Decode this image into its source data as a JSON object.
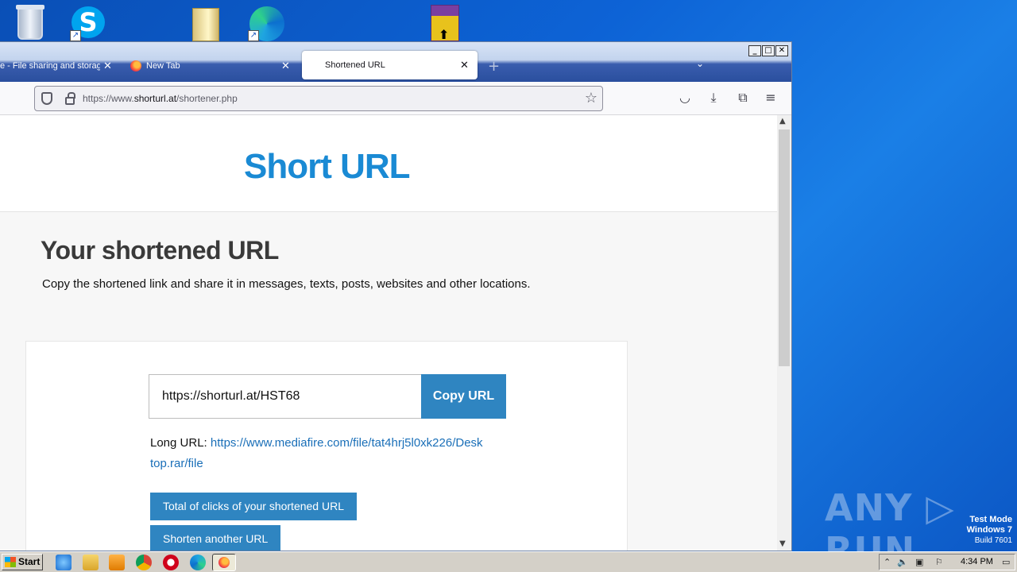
{
  "desktop": {
    "icons": [
      "recycle-bin-icon",
      "skype-icon",
      "folder-icon",
      "edge-icon",
      "winrar-icon"
    ]
  },
  "browser": {
    "tabs": [
      {
        "label": "e - File sharing and storag",
        "active": false
      },
      {
        "label": "New Tab",
        "active": false
      },
      {
        "label": "Shortened URL",
        "active": true
      }
    ],
    "url_prefix": "https://www.",
    "url_domain": "shorturl.at",
    "url_path": "/shortener.php",
    "window_controls": [
      "minimize",
      "maximize",
      "close"
    ]
  },
  "page": {
    "logo": "Short URL",
    "heading": "Your shortened URL",
    "description": "Copy the shortened link and share it in messages, texts, posts, websites and other locations.",
    "short_url": "https://shorturl.at/HST68",
    "copy_button": "Copy URL",
    "long_url_label": "Long URL:",
    "long_url_line1": "https://www.mediafire.com/file/tat4hrj5l0xk226/Desk",
    "long_url_line2": "top.rar/file",
    "clicks_button": "Total of clicks of your shortened URL",
    "shorten_another_button": "Shorten another URL"
  },
  "watermark": {
    "brand": "ANY ▷ RUN",
    "test_mode": "Test Mode",
    "os": "Windows 7",
    "build": "Build 7601"
  },
  "taskbar": {
    "start_label": "Start",
    "clock": "4:34 PM",
    "apps": [
      "ie-icon",
      "explorer-icon",
      "media-player-icon",
      "chrome-icon",
      "opera-icon",
      "edge-icon",
      "firefox-icon"
    ]
  },
  "colors": {
    "accent": "#2f85c1",
    "logo": "#1a8ad4",
    "link": "#1a6fb8"
  }
}
